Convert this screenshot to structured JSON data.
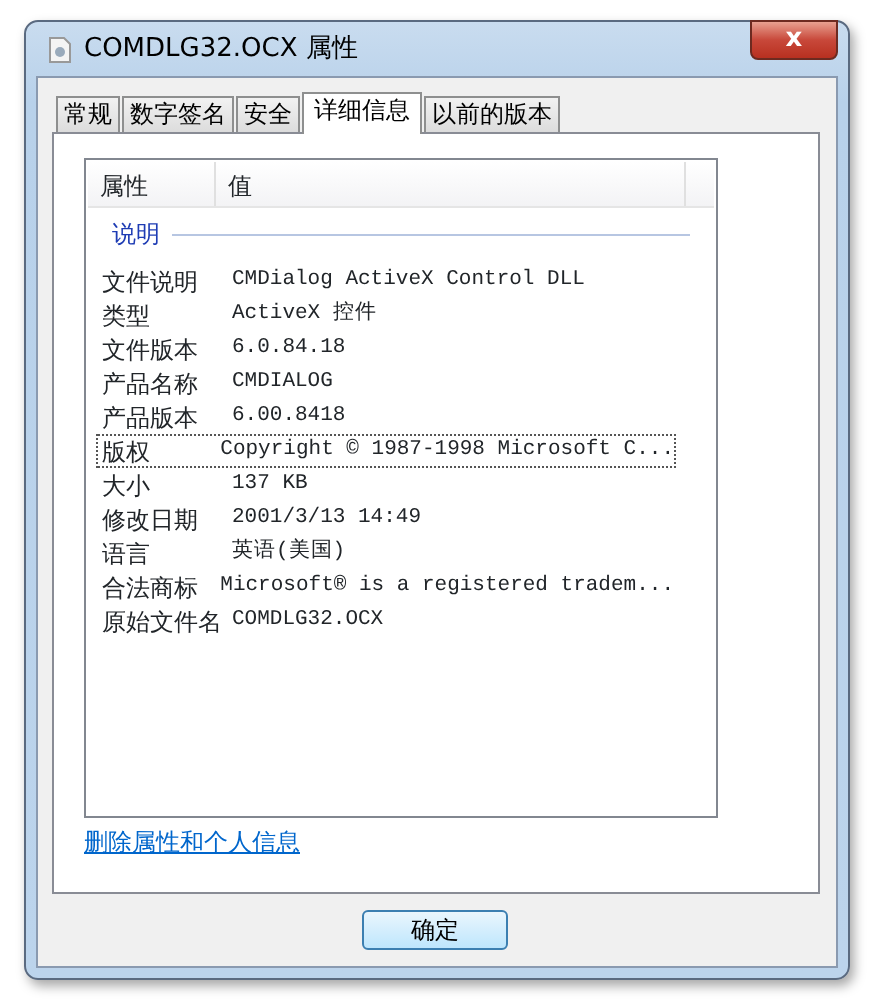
{
  "window": {
    "title": "COMDLG32.OCX 属性",
    "close": "x"
  },
  "tabs": [
    {
      "label": "常规",
      "selected": false
    },
    {
      "label": "数字签名",
      "selected": false
    },
    {
      "label": "安全",
      "selected": false
    },
    {
      "label": "详细信息",
      "selected": true
    },
    {
      "label": "以前的版本",
      "selected": false
    }
  ],
  "table": {
    "columns": [
      "属性",
      "值"
    ],
    "group": "说明",
    "rows": [
      {
        "name": "文件说明",
        "value": "CMDialog ActiveX Control DLL",
        "selected": false
      },
      {
        "name": "类型",
        "value": "ActiveX 控件",
        "selected": false
      },
      {
        "name": "文件版本",
        "value": "6.0.84.18",
        "selected": false
      },
      {
        "name": "产品名称",
        "value": "CMDIALOG",
        "selected": false
      },
      {
        "name": "产品版本",
        "value": "6.00.8418",
        "selected": false
      },
      {
        "name": "版权",
        "value": "Copyright © 1987-1998 Microsoft C...",
        "selected": true
      },
      {
        "name": "大小",
        "value": "137 KB",
        "selected": false
      },
      {
        "name": "修改日期",
        "value": "2001/3/13 14:49",
        "selected": false
      },
      {
        "name": "语言",
        "value": "英语(美国)",
        "selected": false
      },
      {
        "name": "合法商标",
        "value": "Microsoft® is a registered tradem...",
        "selected": false
      },
      {
        "name": "原始文件名",
        "value": "COMDLG32.OCX",
        "selected": false
      }
    ]
  },
  "link": "删除属性和个人信息",
  "buttons": [
    "确定"
  ]
}
